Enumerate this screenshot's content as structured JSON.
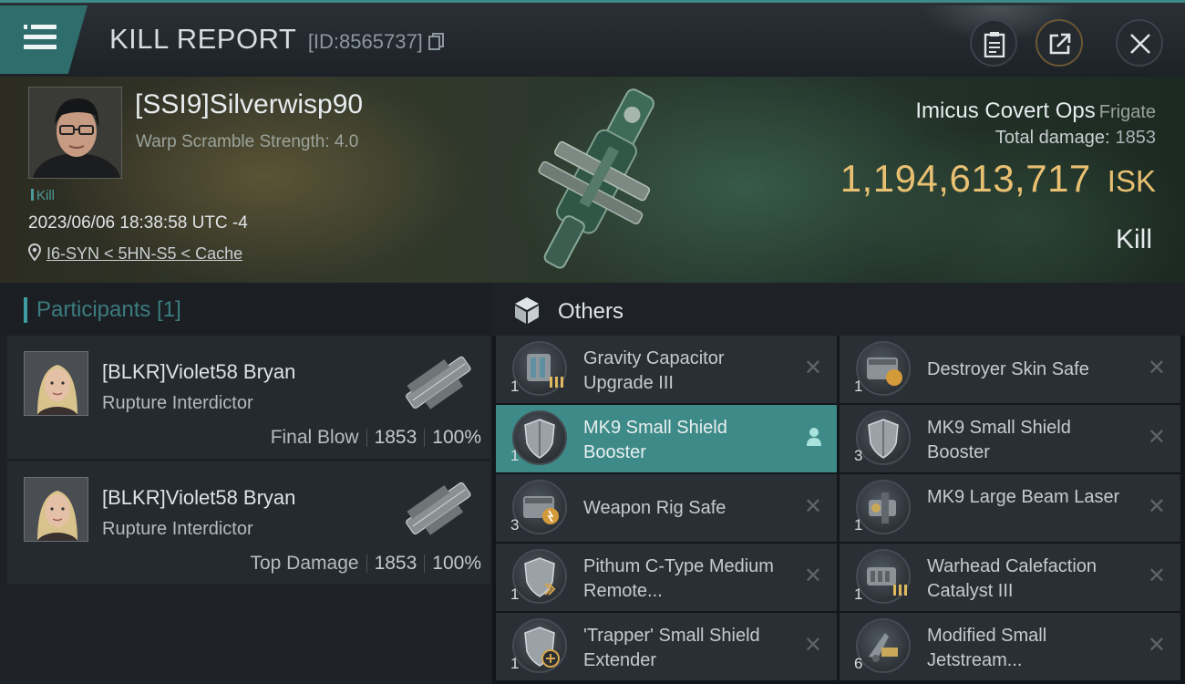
{
  "header": {
    "title": "KILL REPORT",
    "id_label": "[ID:8565737]"
  },
  "victim": {
    "name": "[SSI9]Silverwisp90",
    "warp_scramble": "Warp Scramble Strength: 4.0",
    "tag": "Kill",
    "time": "2023/06/06 18:38:58 UTC -4",
    "location": "I6-SYN < 5HN-S5 < Cache",
    "ship_name": "Imicus Covert Ops",
    "ship_class": "Frigate",
    "total_damage_label": "Total damage:",
    "total_damage": "1853",
    "isk_value": "1,194,613,717",
    "isk_unit": "ISK",
    "result": "Kill"
  },
  "participants": {
    "title": "Participants [1]",
    "rows": [
      {
        "name": "[BLKR]Violet58 Bryan",
        "ship": "Rupture Interdictor",
        "role": "Final Blow",
        "damage": "1853",
        "percent": "100%"
      },
      {
        "name": "[BLKR]Violet58 Bryan",
        "ship": "Rupture Interdictor",
        "role": "Top Damage",
        "damage": "1853",
        "percent": "100%"
      }
    ]
  },
  "others": {
    "title": "Others",
    "items": [
      {
        "name": "Gravity Capacitor Upgrade III",
        "qty": "1",
        "icon": "capacitor-upgrade-icon",
        "status": "destroyed"
      },
      {
        "name": "Destroyer Skin Safe",
        "qty": "1",
        "icon": "skin-safe-icon",
        "status": "destroyed"
      },
      {
        "name": "MK9 Small Shield Booster",
        "qty": "1",
        "icon": "shield-booster-icon",
        "status": "dropped"
      },
      {
        "name": "MK9 Small Shield Booster",
        "qty": "3",
        "icon": "shield-booster-icon",
        "status": "destroyed"
      },
      {
        "name": "Weapon Rig Safe",
        "qty": "3",
        "icon": "rig-safe-icon",
        "status": "destroyed"
      },
      {
        "name": "MK9 Large Beam Laser",
        "qty": "1",
        "icon": "beam-laser-icon",
        "status": "destroyed"
      },
      {
        "name": "Pithum C-Type Medium Remote...",
        "qty": "1",
        "icon": "remote-shield-icon",
        "status": "destroyed"
      },
      {
        "name": "Warhead Calefaction Catalyst III",
        "qty": "1",
        "icon": "warhead-catalyst-icon",
        "status": "destroyed"
      },
      {
        "name": "'Trapper' Small Shield Extender",
        "qty": "1",
        "icon": "shield-extender-icon",
        "status": "destroyed"
      },
      {
        "name": "Modified Small Jetstream...",
        "qty": "6",
        "icon": "jetstream-icon",
        "status": "destroyed"
      }
    ],
    "status_glyphs": {
      "destroyed": "✕",
      "dropped": "person"
    }
  },
  "colors": {
    "accent": "#3d8a88",
    "isk": "#e9c072",
    "selected_row": "#3d8a88"
  }
}
